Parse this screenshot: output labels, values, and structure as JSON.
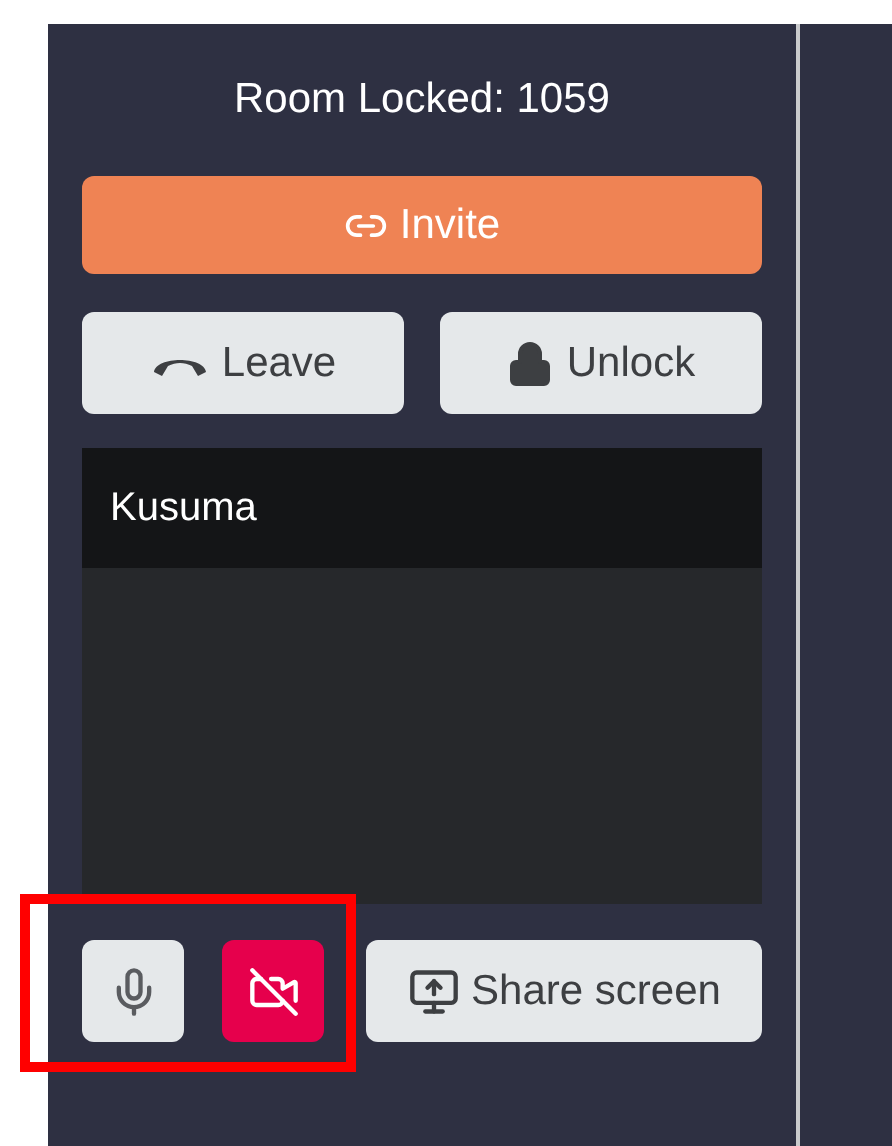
{
  "room_title": "Room Locked: 1059",
  "invite_button": {
    "label": "Invite"
  },
  "actions": [
    {
      "kind": "leave",
      "label": "Leave"
    },
    {
      "kind": "unlock",
      "label": "Unlock"
    }
  ],
  "participant": {
    "name": "Kusuma"
  },
  "media_buttons": [
    {
      "kind": "mic",
      "muted": false
    },
    {
      "kind": "camera",
      "muted": true
    }
  ],
  "share_button": {
    "label": "Share screen"
  }
}
